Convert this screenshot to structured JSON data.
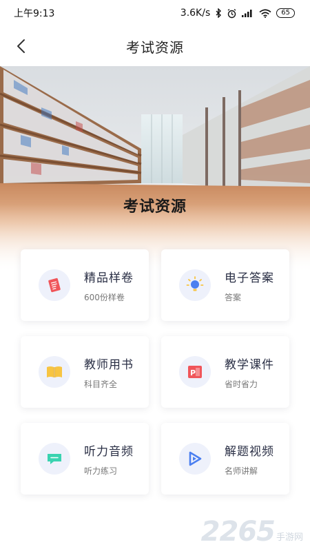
{
  "status_bar": {
    "time": "上午9:13",
    "network_speed": "3.6K/s",
    "battery": "65"
  },
  "header": {
    "title": "考试资源"
  },
  "hero": {
    "title": "考试资源"
  },
  "cards": [
    {
      "title": "精品样卷",
      "subtitle": "600份样卷",
      "icon": "exam-paper-icon"
    },
    {
      "title": "电子答案",
      "subtitle": "答案",
      "icon": "lightbulb-icon"
    },
    {
      "title": "教师用书",
      "subtitle": "科目齐全",
      "icon": "open-book-icon"
    },
    {
      "title": "教学课件",
      "subtitle": "省时省力",
      "icon": "powerpoint-icon"
    },
    {
      "title": "听力音频",
      "subtitle": "听力练习",
      "icon": "chat-bubble-icon"
    },
    {
      "title": "解题视频",
      "subtitle": "名师讲解",
      "icon": "play-icon"
    }
  ],
  "watermark": {
    "number": "2265",
    "text": "手游网"
  },
  "colors": {
    "accent_red": "#f0555a",
    "accent_yellow": "#f7c442",
    "accent_green": "#3ad3b0",
    "accent_blue": "#4b7ff0",
    "icon_bg": "#eef1fb"
  }
}
